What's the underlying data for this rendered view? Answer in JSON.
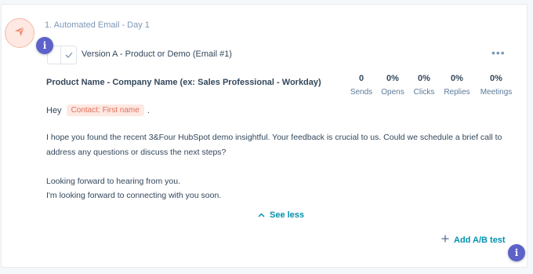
{
  "step": {
    "title": "1. Automated Email - Day 1",
    "icon": "paper-plane-icon",
    "accent": "#f5a08a"
  },
  "info_badge": "i",
  "version": {
    "label": "Version A - Product or Demo (Email #1)",
    "menu": "•••"
  },
  "email": {
    "subject": "Product Name - Company Name (ex: Sales Professional - Workday)",
    "greeting": "Hey",
    "token": "Contact: First name",
    "greeting_end": ".",
    "paragraph1_line1": "I hope you found the recent 3&Four HubSpot demo insightful. Your feedback is crucial to us. Could we schedule a brief call to",
    "paragraph1_line2": "address any questions or discuss the next steps?",
    "closing_line1": "Looking forward to hearing from you.",
    "closing_line2": "I'm looking forward to connecting with you soon."
  },
  "stats": [
    {
      "value": "0",
      "label": "Sends"
    },
    {
      "value": "0%",
      "label": "Opens"
    },
    {
      "value": "0%",
      "label": "Clicks"
    },
    {
      "value": "0%",
      "label": "Replies"
    },
    {
      "value": "0%",
      "label": "Meetings"
    }
  ],
  "actions": {
    "see_less": "See less",
    "add_ab_test": "Add A/B test"
  },
  "colors": {
    "link": "#0091ae",
    "badge": "#5c62c9",
    "token_bg": "#fde8e2",
    "token_text": "#e06f5a"
  }
}
